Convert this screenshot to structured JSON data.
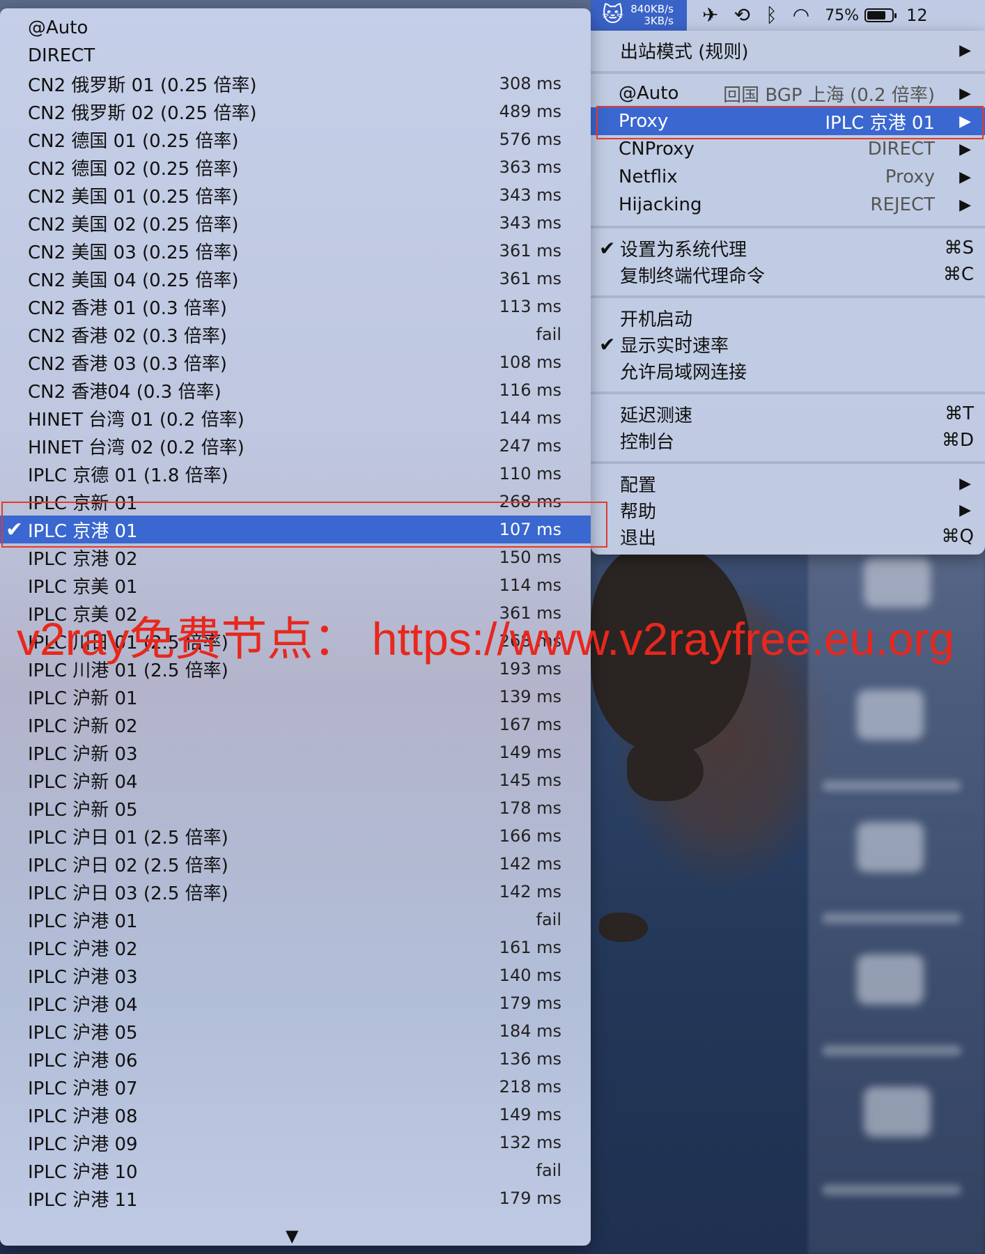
{
  "menubar": {
    "speed_down": "840KB/s",
    "speed_up": "3KB/s",
    "battery_percent": "75%",
    "battery_level": 0.75,
    "clock": "12"
  },
  "right_menu": {
    "outbound_mode": {
      "label": "出站模式 (规则)"
    },
    "groups": [
      {
        "label": "@Auto",
        "value": "回国 BGP 上海 (0.2 倍率)"
      },
      {
        "label": "Proxy",
        "value": "IPLC 京港 01",
        "selected": true
      },
      {
        "label": "CNProxy",
        "value": "DIRECT"
      },
      {
        "label": "Netflix",
        "value": "Proxy"
      },
      {
        "label": "Hijacking",
        "value": "REJECT"
      }
    ],
    "system_proxy": {
      "label": "设置为系统代理",
      "shortcut": "⌘S",
      "checked": true
    },
    "copy_terminal": {
      "label": "复制终端代理命令",
      "shortcut": "⌘C"
    },
    "launch_at_login": {
      "label": "开机启动"
    },
    "show_speed": {
      "label": "显示实时速率",
      "checked": true
    },
    "allow_lan": {
      "label": "允许局域网连接"
    },
    "latency_test": {
      "label": "延迟测速",
      "shortcut": "⌘T"
    },
    "console": {
      "label": "控制台",
      "shortcut": "⌘D"
    },
    "config": {
      "label": "配置"
    },
    "help": {
      "label": "帮助"
    },
    "quit": {
      "label": "退出",
      "shortcut": "⌘Q"
    }
  },
  "proxy_list": [
    {
      "name": "@Auto",
      "latency": ""
    },
    {
      "name": "DIRECT",
      "latency": ""
    },
    {
      "name": "CN2 俄罗斯 01 (0.25 倍率)",
      "latency": "308 ms"
    },
    {
      "name": "CN2 俄罗斯 02 (0.25 倍率)",
      "latency": "489 ms"
    },
    {
      "name": "CN2 德国 01 (0.25 倍率)",
      "latency": "576 ms"
    },
    {
      "name": "CN2 德国 02 (0.25 倍率)",
      "latency": "363 ms"
    },
    {
      "name": "CN2 美国 01 (0.25 倍率)",
      "latency": "343 ms"
    },
    {
      "name": "CN2 美国 02 (0.25 倍率)",
      "latency": "343 ms"
    },
    {
      "name": "CN2 美国 03 (0.25 倍率)",
      "latency": "361 ms"
    },
    {
      "name": "CN2 美国 04 (0.25 倍率)",
      "latency": "361 ms"
    },
    {
      "name": "CN2 香港 01 (0.3 倍率)",
      "latency": "113 ms"
    },
    {
      "name": "CN2 香港 02 (0.3 倍率)",
      "latency": "fail"
    },
    {
      "name": "CN2 香港 03 (0.3 倍率)",
      "latency": "108 ms"
    },
    {
      "name": "CN2 香港04 (0.3 倍率)",
      "latency": "116 ms"
    },
    {
      "name": "HINET 台湾 01 (0.2 倍率)",
      "latency": "144 ms"
    },
    {
      "name": "HINET 台湾 02 (0.2 倍率)",
      "latency": "247 ms"
    },
    {
      "name": "IPLC 京德 01 (1.8 倍率)",
      "latency": "110 ms"
    },
    {
      "name": "IPLC 京新 01",
      "latency": "268 ms"
    },
    {
      "name": "IPLC 京港 01",
      "latency": "107 ms",
      "selected": true
    },
    {
      "name": "IPLC 京港 02",
      "latency": "150 ms"
    },
    {
      "name": "IPLC 京美 01",
      "latency": "114 ms"
    },
    {
      "name": "IPLC 京美 02",
      "latency": "361 ms"
    },
    {
      "name": "IPLC 川日 01 (2.5 倍率)",
      "latency": "268 ms"
    },
    {
      "name": "IPLC 川港 01 (2.5 倍率)",
      "latency": "193 ms"
    },
    {
      "name": "IPLC 沪新 01",
      "latency": "139 ms"
    },
    {
      "name": "IPLC 沪新 02",
      "latency": "167 ms"
    },
    {
      "name": "IPLC 沪新 03",
      "latency": "149 ms"
    },
    {
      "name": "IPLC 沪新 04",
      "latency": "145 ms"
    },
    {
      "name": "IPLC 沪新 05",
      "latency": "178 ms"
    },
    {
      "name": "IPLC 沪日 01 (2.5 倍率)",
      "latency": "166 ms"
    },
    {
      "name": "IPLC 沪日 02 (2.5 倍率)",
      "latency": "142 ms"
    },
    {
      "name": "IPLC 沪日 03 (2.5 倍率)",
      "latency": "142 ms"
    },
    {
      "name": "IPLC 沪港 01",
      "latency": "fail"
    },
    {
      "name": "IPLC 沪港 02",
      "latency": "161 ms"
    },
    {
      "name": "IPLC 沪港 03",
      "latency": "140 ms"
    },
    {
      "name": "IPLC 沪港 04",
      "latency": "179 ms"
    },
    {
      "name": "IPLC 沪港 05",
      "latency": "184 ms"
    },
    {
      "name": "IPLC 沪港 06",
      "latency": "136 ms"
    },
    {
      "name": "IPLC 沪港 07",
      "latency": "218 ms"
    },
    {
      "name": "IPLC 沪港 08",
      "latency": "149 ms"
    },
    {
      "name": "IPLC 沪港 09",
      "latency": "132 ms"
    },
    {
      "name": "IPLC 沪港 10",
      "latency": "fail"
    },
    {
      "name": "IPLC 沪港 11",
      "latency": "179 ms"
    }
  ],
  "watermark": "v2ray免费节点：  https://www.v2rayfree.eu.org",
  "colors": {
    "selection": "#3a67d0",
    "highlight_box": "#e23a2a",
    "watermark": "#e8271d",
    "menubar_app_bg": "#3a63c8"
  },
  "icons": {
    "app": "cat-icon",
    "checkmark": "checkmark-icon",
    "submenu": "triangle-right-icon",
    "scroll": "triangle-down-icon"
  }
}
